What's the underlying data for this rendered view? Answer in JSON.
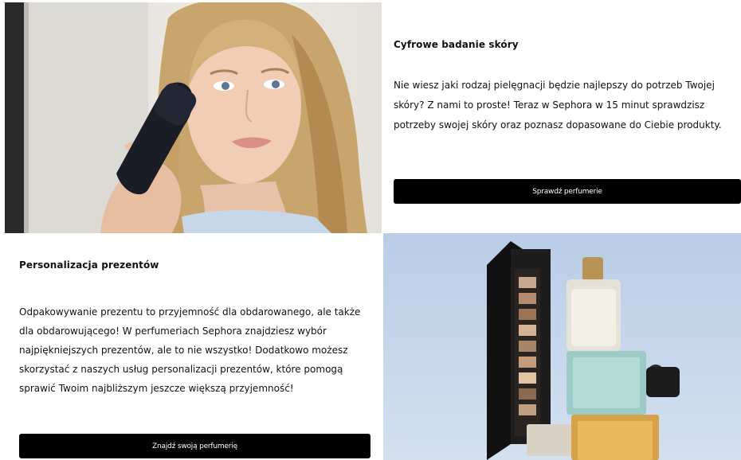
{
  "skin_test": {
    "title": "Cyfrowe badanie skóry",
    "description": "Nie wiesz jaki rodzaj pielęgnacji będzie najlepszy do potrzeb Twojej skóry? Z nami to proste! Teraz w Sephora w 15 minut sprawdzisz potrzeby swojej skóry oraz poznasz dopasowane do Ciebie produkty.",
    "button_label": "Sprawdź perfumerie"
  },
  "gift_personalization": {
    "title": "Personalizacja prezentów",
    "description": "Odpakowywanie prezentu to przyjemność dla obdarowanego, ale także dla obdarowującego! W perfumeriach Sephora znajdziesz wybór najpiękniejszych prezentów, ale to nie wszystko! Dodatkowo możesz skorzystać z naszych usług personalizacji prezentów, które pomogą sprawić Twoim najbliższym jeszcze większą przyjemność!",
    "button_label": "Znajdź swoją perfumerię"
  },
  "colors": {
    "button_bg": "#000000",
    "button_text": "#ffffff",
    "text": "#111111"
  }
}
